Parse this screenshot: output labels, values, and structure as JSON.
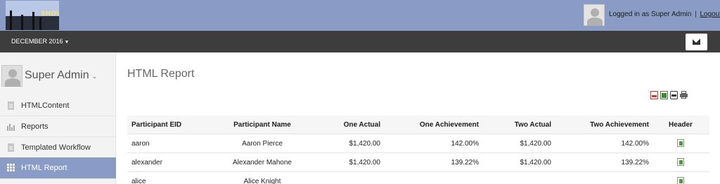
{
  "header": {
    "logo_text": "SHOW",
    "login_prefix": "Logged in as Super Admin",
    "separator": "|",
    "logout_label": "Logout"
  },
  "toolbar": {
    "period_label": "DECEMBER 2016",
    "period_icon": "chevron-down-icon",
    "mail_icon": "envelope-icon"
  },
  "sidebar": {
    "user_name": "Super Admin",
    "items": [
      {
        "label": "HTMLContent",
        "icon": "document-icon",
        "active": false
      },
      {
        "label": "Reports",
        "icon": "bar-chart-icon",
        "active": false
      },
      {
        "label": "Templated Workflow",
        "icon": "document-icon",
        "active": false
      },
      {
        "label": "HTML Report",
        "icon": "grid-icon",
        "active": true
      }
    ],
    "active_color": "#8a9cc6"
  },
  "main": {
    "title": "HTML Report",
    "export_icons": [
      "pdf-export-icon",
      "excel-export-icon",
      "csv-export-icon",
      "print-icon"
    ],
    "table": {
      "columns": [
        "Participant EID",
        "Participant Name",
        "One Actual",
        "One Achievement",
        "Two Actual",
        "Two Achievement",
        "Header"
      ],
      "rows": [
        [
          "aaron",
          "Aaron Pierce",
          "$1,420.00",
          "142.00%",
          "$1,420.00",
          "142.00%",
          "excel-icon"
        ],
        [
          "alexander",
          "Alexander Mahone",
          "$1,420.00",
          "139.22%",
          "$1,420.00",
          "139.22%",
          "excel-icon"
        ],
        [
          "alice",
          "Alice Knight",
          "",
          "",
          "",
          "",
          "excel-icon"
        ]
      ]
    }
  },
  "colors": {
    "header_bg": "#8a9cc6",
    "darkbar_bg": "#3d3d3d"
  }
}
